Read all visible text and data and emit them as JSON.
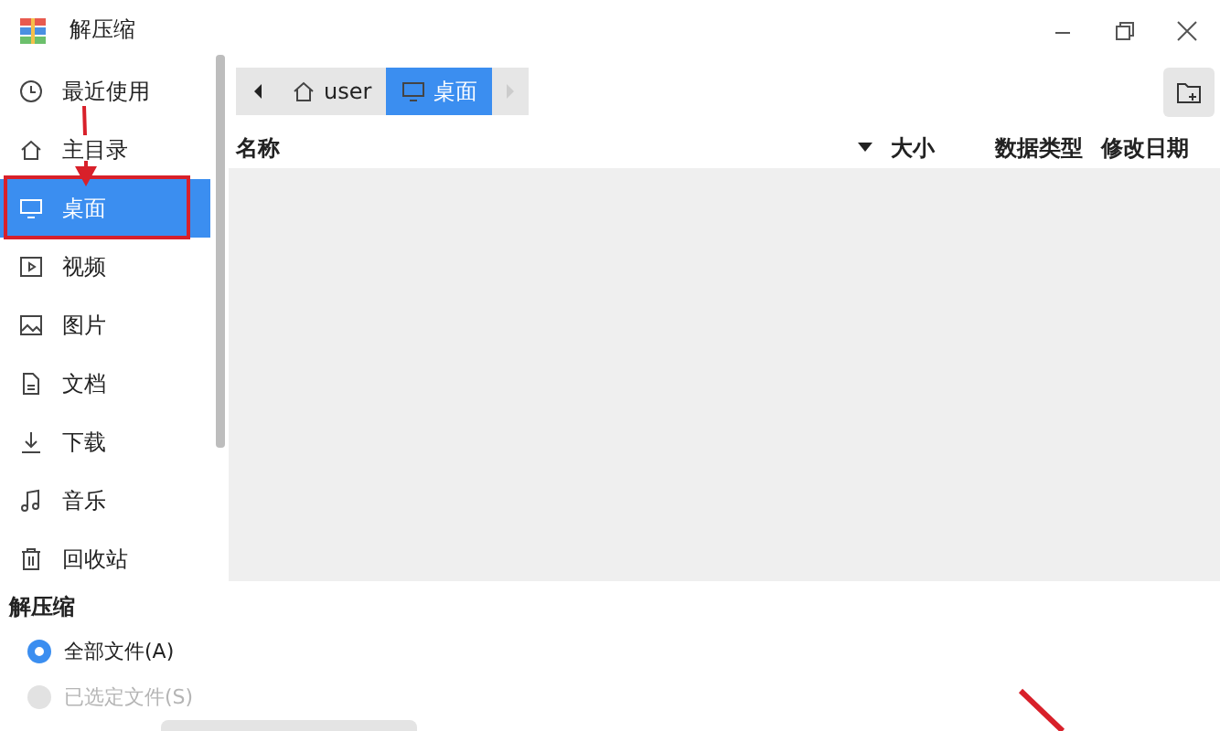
{
  "window": {
    "title": "解压缩"
  },
  "sidebar": {
    "items": [
      {
        "label": "最近使用",
        "selected": false
      },
      {
        "label": "主目录",
        "selected": false
      },
      {
        "label": "桌面",
        "selected": true
      },
      {
        "label": "视频",
        "selected": false
      },
      {
        "label": "图片",
        "selected": false
      },
      {
        "label": "文档",
        "selected": false
      },
      {
        "label": "下载",
        "selected": false
      },
      {
        "label": "音乐",
        "selected": false
      },
      {
        "label": "回收站",
        "selected": false
      }
    ]
  },
  "breadcrumb": [
    {
      "label": "user",
      "selected": false
    },
    {
      "label": "桌面",
      "selected": true
    }
  ],
  "table": {
    "columns": [
      {
        "label": "名称",
        "sorted": true
      },
      {
        "label": "大小",
        "sorted": false
      },
      {
        "label": "数据类型",
        "sorted": false
      },
      {
        "label": "修改日期",
        "sorted": false
      }
    ]
  },
  "extract": {
    "title": "解压缩",
    "options": [
      {
        "label": "全部文件(A)",
        "selected": true,
        "disabled": false
      },
      {
        "label": "已选定文件(S)",
        "selected": false,
        "disabled": true
      }
    ]
  }
}
